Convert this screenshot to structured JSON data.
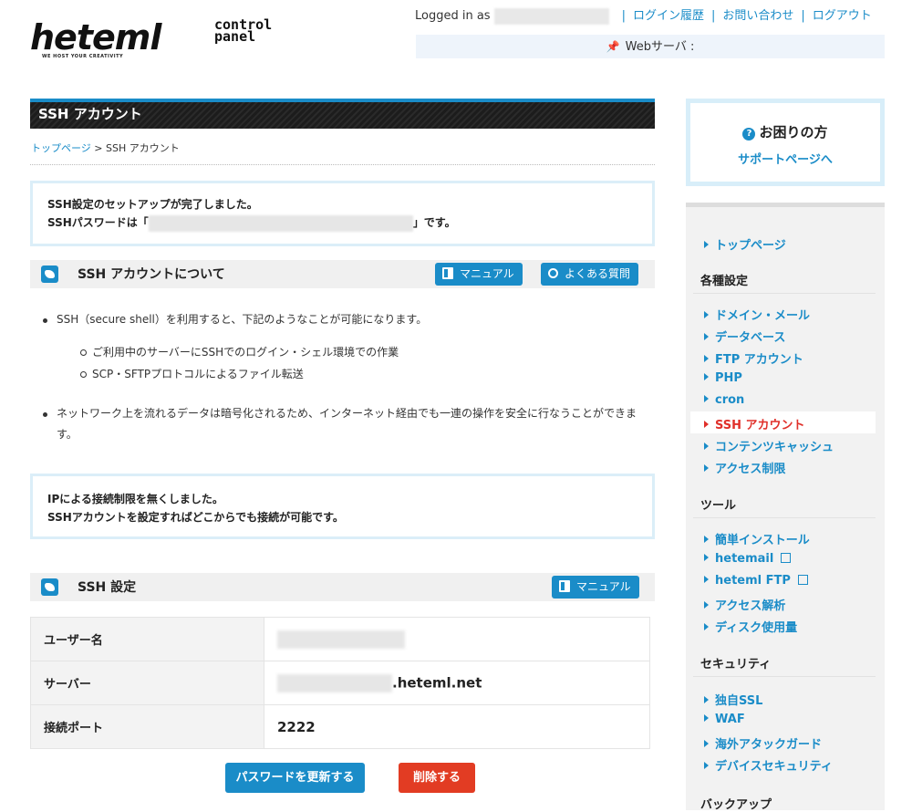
{
  "header": {
    "logo_text": "heteml",
    "logo_sub": "control panel",
    "logo_tagline": "WE HOST YOUR CREATIVITY",
    "logged_in_label": "Logged in as",
    "links": [
      "ログイン履歴",
      "お問い合わせ",
      "ログアウト"
    ],
    "server_label": "Webサーバ :"
  },
  "page": {
    "title": "SSH アカウント",
    "breadcrumb_home": "トップページ",
    "breadcrumb_sep": " > ",
    "breadcrumb_current": "SSH アカウント"
  },
  "notice1": {
    "line1": "SSH設定のセットアップが完了しました。",
    "line2_prefix": "SSHパスワードは「",
    "line2_suffix": "」です。"
  },
  "about": {
    "title": "SSH アカウントについて",
    "manual_label": "マニュアル",
    "faq_label": "よくある質問",
    "bullet1": "SSH（secure shell）を利用すると、下記のようなことが可能になります。",
    "sub_items": [
      "ご利用中のサーバーにSSHでのログイン・シェル環境での作業",
      "SCP・SFTPプロトコルによるファイル転送"
    ],
    "bullet2": "ネットワーク上を流れるデータは暗号化されるため、インターネット経由でも一連の操作を安全に行なうことができます。"
  },
  "notice2": {
    "line1": "IPによる接続制限を無くしました。",
    "line2": "SSHアカウントを設定すればどこからでも接続が可能です。"
  },
  "settings": {
    "title": "SSH 設定",
    "manual_label": "マニュアル",
    "rows": [
      {
        "key": "ユーザー名",
        "value": ""
      },
      {
        "key": "サーバー",
        "value": ".heteml.net"
      },
      {
        "key": "接続ポート",
        "value": "2222"
      }
    ],
    "update_button": "パスワードを更新する",
    "delete_button": "削除する"
  },
  "help": {
    "title": "お困りの方",
    "link": "サポートページへ"
  },
  "sidebar": {
    "top": "トップページ",
    "cat_settings": "各種設定",
    "settings_items": [
      "ドメイン・メール",
      "データベース",
      "FTP アカウント",
      "PHP",
      "cron",
      "SSH アカウント",
      "コンテンツキャッシュ",
      "アクセス制限"
    ],
    "cat_tools": "ツール",
    "tools_items": [
      "簡単インストール",
      "hetemail",
      "heteml FTP",
      "アクセス解析",
      "ディスク使用量"
    ],
    "cat_security": "セキュリティ",
    "security_items": [
      "独自SSL",
      "WAF",
      "海外アタックガード",
      "デバイスセキュリティ"
    ],
    "cat_backup": "バックアップ"
  },
  "colors": {
    "accent": "#1a8cc8",
    "danger": "#e23c23",
    "active_nav": "#e0302a"
  }
}
